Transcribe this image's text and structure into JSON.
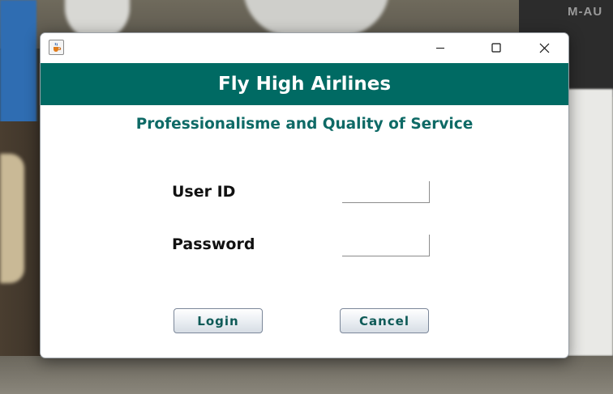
{
  "desktop": {
    "background_text": "M-AU"
  },
  "window": {
    "app_icon": "java-cup-icon",
    "controls": {
      "minimize_icon": "minimize-icon",
      "maximize_icon": "maximize-icon",
      "close_icon": "close-icon"
    },
    "header_title": "Fly High Airlines",
    "subtitle": "Professionalisme and Quality of Service",
    "form": {
      "user_id_label": "User ID",
      "user_id_value": "",
      "password_label": "Password",
      "password_value": ""
    },
    "buttons": {
      "login_label": "Login",
      "cancel_label": "Cancel"
    }
  },
  "colors": {
    "header_bg": "#006a63",
    "subtitle_text": "#0e6a66",
    "button_text": "#0e5a57"
  }
}
